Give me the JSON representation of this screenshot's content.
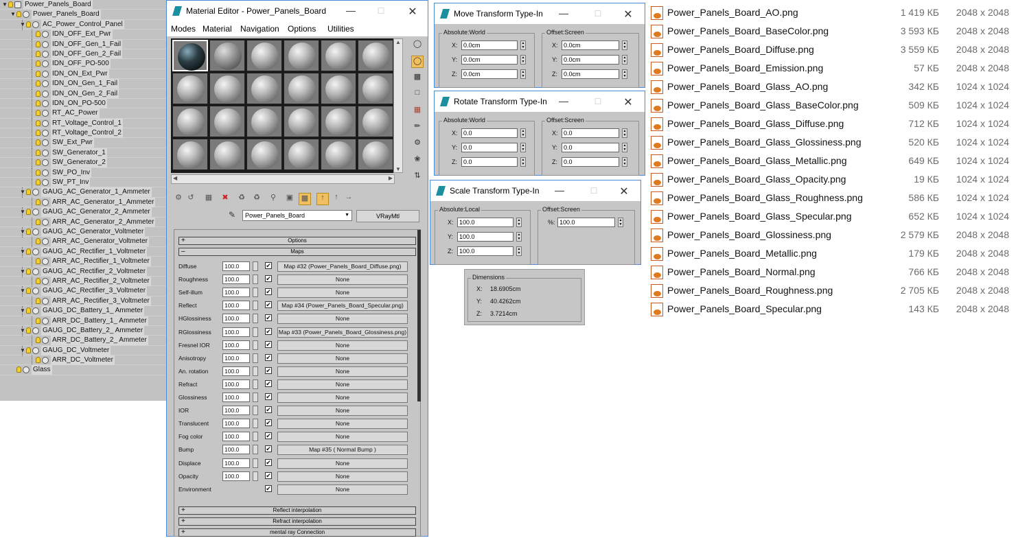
{
  "scene_explorer": {
    "items": [
      {
        "label": "Power_Panels_Board",
        "depth": 0,
        "icon": "group-icon"
      },
      {
        "label": "Power_Panels_Board",
        "depth": 1,
        "icon": "bulb"
      },
      {
        "label": "AC_Power_Control_Panel",
        "depth": 2,
        "icon": "bulb"
      },
      {
        "label": "IDN_OFF_Ext_Pwr",
        "depth": 3,
        "icon": "bulb"
      },
      {
        "label": "IDN_OFF_Gen_1_Fail",
        "depth": 3,
        "icon": "bulb"
      },
      {
        "label": "IDN_OFF_Gen_2_Fail",
        "depth": 3,
        "icon": "bulb"
      },
      {
        "label": "IDN_OFF_PO-500",
        "depth": 3,
        "icon": "bulb"
      },
      {
        "label": "IDN_ON_Ext_Pwr",
        "depth": 3,
        "icon": "bulb"
      },
      {
        "label": "IDN_ON_Gen_1_Fail",
        "depth": 3,
        "icon": "bulb"
      },
      {
        "label": "IDN_ON_Gen_2_Fail",
        "depth": 3,
        "icon": "bulb"
      },
      {
        "label": "IDN_ON_PO-500",
        "depth": 3,
        "icon": "bulb"
      },
      {
        "label": "RT_AC_Power",
        "depth": 3,
        "icon": "bulb"
      },
      {
        "label": "RT_Voltage_Control_1",
        "depth": 3,
        "icon": "bulb"
      },
      {
        "label": "RT_Voltage_Control_2",
        "depth": 3,
        "icon": "bulb"
      },
      {
        "label": "SW_Ext_Pwr",
        "depth": 3,
        "icon": "bulb"
      },
      {
        "label": "SW_Generator_1",
        "depth": 3,
        "icon": "bulb"
      },
      {
        "label": "SW_Generator_2",
        "depth": 3,
        "icon": "bulb"
      },
      {
        "label": "SW_PO_Inv",
        "depth": 3,
        "icon": "bulb"
      },
      {
        "label": "SW_PT_Inv",
        "depth": 3,
        "icon": "bulb"
      },
      {
        "label": "GAUG_AC_Generator_1_Ammeter",
        "depth": 2,
        "icon": "bulb"
      },
      {
        "label": "ARR_AC_Generator_1_Ammeter",
        "depth": 3,
        "icon": "bulb"
      },
      {
        "label": "GAUG_AC_Generator_2_Ammeter",
        "depth": 2,
        "icon": "bulb"
      },
      {
        "label": "ARR_AC_Generator_2_Ammeter",
        "depth": 3,
        "icon": "bulb"
      },
      {
        "label": "GAUG_AC_Generator_Voltmeter",
        "depth": 2,
        "icon": "bulb"
      },
      {
        "label": "ARR_AC_Generator_Voltmeter",
        "depth": 3,
        "icon": "bulb"
      },
      {
        "label": "GAUG_AC_Rectifier_1_Voltmeter",
        "depth": 2,
        "icon": "bulb"
      },
      {
        "label": "ARR_AC_Rectifier_1_Voltmeter",
        "depth": 3,
        "icon": "bulb"
      },
      {
        "label": "GAUG_AC_Rectifier_2_Voltmeter",
        "depth": 2,
        "icon": "bulb"
      },
      {
        "label": "ARR_AC_Rectifier_2_Voltmeter",
        "depth": 3,
        "icon": "bulb"
      },
      {
        "label": "GAUG_AC_Rectifier_3_Voltmeter",
        "depth": 2,
        "icon": "bulb"
      },
      {
        "label": "ARR_AC_Rectifier_3_Voltmeter",
        "depth": 3,
        "icon": "bulb"
      },
      {
        "label": "GAUG_DC_Battery_1_ Ammeter",
        "depth": 2,
        "icon": "bulb"
      },
      {
        "label": "ARR_DC_Battery_1_ Ammeter",
        "depth": 3,
        "icon": "bulb"
      },
      {
        "label": "GAUG_DC_Battery_2_ Ammeter",
        "depth": 2,
        "icon": "bulb"
      },
      {
        "label": "ARR_DC_Battery_2_ Ammeter",
        "depth": 3,
        "icon": "bulb"
      },
      {
        "label": "GAUG_DC_Voltmeter",
        "depth": 2,
        "icon": "bulb"
      },
      {
        "label": "ARR_DC_Voltmeter",
        "depth": 3,
        "icon": "bulb"
      },
      {
        "label": "Glass",
        "depth": 1,
        "icon": "bulb"
      }
    ]
  },
  "material_editor": {
    "title": "Material Editor - Power_Panels_Board",
    "menu": [
      "Modes",
      "Material",
      "Navigation",
      "Options",
      "Utilities"
    ],
    "material_name": "Power_Panels_Board",
    "material_type": "VRayMtl",
    "rollouts": {
      "options": "Options",
      "maps": "Maps",
      "reflect_interp": "Reflect interpolation",
      "refract_interp": "Refract interpolation",
      "mental_ray": "mental ray Connection"
    },
    "maps": [
      {
        "name": "Diffuse",
        "value": "100.0",
        "checked": true,
        "map": "Map #32 (Power_Panels_Board_Diffuse.png)"
      },
      {
        "name": "Roughness",
        "value": "100.0",
        "checked": true,
        "map": "None"
      },
      {
        "name": "Self-illum",
        "value": "100.0",
        "checked": true,
        "map": "None"
      },
      {
        "name": "Reflect",
        "value": "100.0",
        "checked": true,
        "map": "Map #34 (Power_Panels_Board_Specular.png)"
      },
      {
        "name": "HGlossiness",
        "value": "100.0",
        "checked": true,
        "map": "None"
      },
      {
        "name": "RGlossiness",
        "value": "100.0",
        "checked": true,
        "map": "Map #33 (Power_Panels_Board_Glossiness.png)"
      },
      {
        "name": "Fresnel IOR",
        "value": "100.0",
        "checked": true,
        "map": "None"
      },
      {
        "name": "Anisotropy",
        "value": "100.0",
        "checked": true,
        "map": "None"
      },
      {
        "name": "An. rotation",
        "value": "100.0",
        "checked": true,
        "map": "None"
      },
      {
        "name": "Refract",
        "value": "100.0",
        "checked": true,
        "map": "None"
      },
      {
        "name": "Glossiness",
        "value": "100.0",
        "checked": true,
        "map": "None"
      },
      {
        "name": "IOR",
        "value": "100.0",
        "checked": true,
        "map": "None"
      },
      {
        "name": "Translucent",
        "value": "100.0",
        "checked": true,
        "map": "None"
      },
      {
        "name": "Fog color",
        "value": "100.0",
        "checked": true,
        "map": "None"
      },
      {
        "name": "Bump",
        "value": "100.0",
        "checked": true,
        "map": "Map #35  ( Normal Bump )"
      },
      {
        "name": "Displace",
        "value": "100.0",
        "checked": true,
        "map": "None"
      },
      {
        "name": "Opacity",
        "value": "100.0",
        "checked": true,
        "map": "None"
      },
      {
        "name": "Environment",
        "value": "",
        "checked": true,
        "map": "None"
      }
    ]
  },
  "move_dialog": {
    "title": "Move Transform Type-In",
    "abs_label": "Absolute:World",
    "off_label": "Offset:Screen",
    "abs": [
      {
        "axis": "X:",
        "value": "0.0cm"
      },
      {
        "axis": "Y:",
        "value": "0.0cm"
      },
      {
        "axis": "Z:",
        "value": "0.0cm"
      }
    ],
    "off": [
      {
        "axis": "X:",
        "value": "0.0cm"
      },
      {
        "axis": "Y:",
        "value": "0.0cm"
      },
      {
        "axis": "Z:",
        "value": "0.0cm"
      }
    ]
  },
  "rotate_dialog": {
    "title": "Rotate Transform Type-In",
    "abs_label": "Absolute:World",
    "off_label": "Offset:Screen",
    "abs": [
      {
        "axis": "X:",
        "value": "0.0"
      },
      {
        "axis": "Y:",
        "value": "0.0"
      },
      {
        "axis": "Z:",
        "value": "0.0"
      }
    ],
    "off": [
      {
        "axis": "X:",
        "value": "0.0"
      },
      {
        "axis": "Y:",
        "value": "0.0"
      },
      {
        "axis": "Z:",
        "value": "0.0"
      }
    ]
  },
  "scale_dialog": {
    "title": "Scale Transform Type-In",
    "abs_label": "Absolute:Local",
    "off_label": "Offset:Screen",
    "abs": [
      {
        "axis": "X:",
        "value": "100.0"
      },
      {
        "axis": "Y:",
        "value": "100.0"
      },
      {
        "axis": "Z:",
        "value": "100.0"
      }
    ],
    "off": [
      {
        "axis": "%:",
        "value": "100.0"
      }
    ]
  },
  "dimensions": {
    "label": "Dimensions",
    "rows": [
      {
        "axis": "X:",
        "value": "18.6905cm"
      },
      {
        "axis": "Y:",
        "value": "40.4262cm"
      },
      {
        "axis": "Z:",
        "value": "3.7214cm"
      }
    ]
  },
  "files": [
    {
      "name": "Power_Panels_Board_AO.png",
      "size": "1 419 КБ",
      "dims": "2048 x 2048"
    },
    {
      "name": "Power_Panels_Board_BaseColor.png",
      "size": "3 593 КБ",
      "dims": "2048 x 2048"
    },
    {
      "name": "Power_Panels_Board_Diffuse.png",
      "size": "3 559 КБ",
      "dims": "2048 x 2048"
    },
    {
      "name": "Power_Panels_Board_Emission.png",
      "size": "57 КБ",
      "dims": "2048 x 2048"
    },
    {
      "name": "Power_Panels_Board_Glass_AO.png",
      "size": "342 КБ",
      "dims": "1024 x 1024"
    },
    {
      "name": "Power_Panels_Board_Glass_BaseColor.png",
      "size": "509 КБ",
      "dims": "1024 x 1024"
    },
    {
      "name": "Power_Panels_Board_Glass_Diffuse.png",
      "size": "712 КБ",
      "dims": "1024 x 1024"
    },
    {
      "name": "Power_Panels_Board_Glass_Glossiness.png",
      "size": "520 КБ",
      "dims": "1024 x 1024"
    },
    {
      "name": "Power_Panels_Board_Glass_Metallic.png",
      "size": "649 КБ",
      "dims": "1024 x 1024"
    },
    {
      "name": "Power_Panels_Board_Glass_Opacity.png",
      "size": "19 КБ",
      "dims": "1024 x 1024"
    },
    {
      "name": "Power_Panels_Board_Glass_Roughness.png",
      "size": "586 КБ",
      "dims": "1024 x 1024"
    },
    {
      "name": "Power_Panels_Board_Glass_Specular.png",
      "size": "652 КБ",
      "dims": "1024 x 1024"
    },
    {
      "name": "Power_Panels_Board_Glossiness.png",
      "size": "2 579 КБ",
      "dims": "2048 x 2048"
    },
    {
      "name": "Power_Panels_Board_Metallic.png",
      "size": "179 КБ",
      "dims": "2048 x 2048"
    },
    {
      "name": "Power_Panels_Board_Normal.png",
      "size": "766 КБ",
      "dims": "2048 x 2048"
    },
    {
      "name": "Power_Panels_Board_Roughness.png",
      "size": "2 705 КБ",
      "dims": "2048 x 2048"
    },
    {
      "name": "Power_Panels_Board_Specular.png",
      "size": "143 КБ",
      "dims": "2048 x 2048"
    }
  ]
}
